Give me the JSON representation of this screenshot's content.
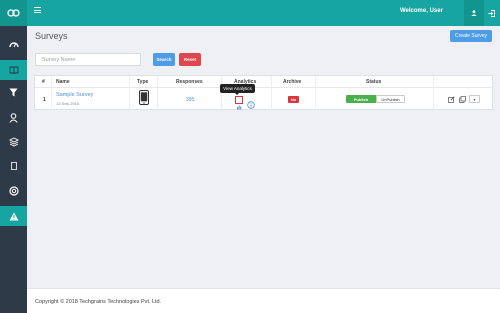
{
  "topbar": {
    "welcome": "Welcome, User",
    "accent": "#16a5a0"
  },
  "sidebar": {
    "items": [
      {
        "icon": "dashboard-icon"
      },
      {
        "icon": "book-icon",
        "active": true
      },
      {
        "icon": "filter-icon"
      },
      {
        "icon": "user-icon"
      },
      {
        "icon": "layers-icon"
      },
      {
        "icon": "square-icon"
      },
      {
        "icon": "lifebuoy-icon"
      },
      {
        "icon": "warning-icon"
      }
    ]
  },
  "page": {
    "title": "Surveys",
    "create_label": "Create Survey"
  },
  "filters": {
    "search_placeholder": "Survey Name",
    "search_label": "Search",
    "reset_label": "Reset"
  },
  "table": {
    "headers": {
      "num": "#",
      "name": "Name",
      "type": "Type",
      "responses": "Responses",
      "analytics": "Analytics",
      "archive": "Archive",
      "status": "Status"
    },
    "rows": [
      {
        "num": "1",
        "name": "Sample Survey",
        "date": "12-Sep-2016",
        "type_icon": "mobile-icon",
        "responses": "395",
        "archive": "No",
        "publish_label": "Publish",
        "unpublish_label": "UnPublish"
      }
    ],
    "tooltip": "View Analytics"
  },
  "footer": {
    "text": "Copyright © 2018 Techgrains Technologies Pvt. Ltd."
  }
}
